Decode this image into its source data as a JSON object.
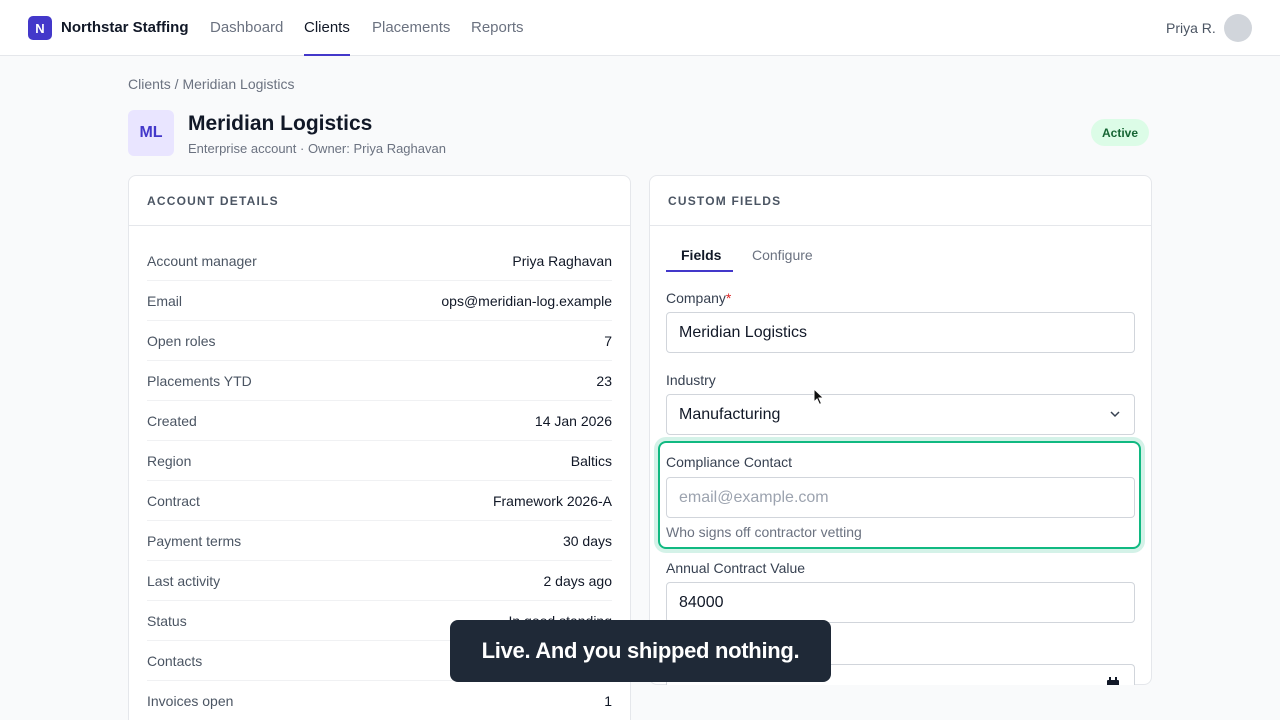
{
  "nav": {
    "logo_letter": "N",
    "brand": "Northstar Staffing",
    "links": [
      "Dashboard",
      "Clients",
      "Placements",
      "Reports"
    ],
    "user": "Priya R."
  },
  "breadcrumb": "Clients / Meridian Logistics",
  "client": {
    "initials": "ML",
    "name": "Meridian Logistics",
    "subtitle": "Enterprise account · Owner: Priya Raghavan",
    "status": "Active"
  },
  "account_details": {
    "header": "ACCOUNT DETAILS",
    "rows": [
      {
        "label": "Account manager",
        "value": "Priya Raghavan"
      },
      {
        "label": "Email",
        "value": "ops@meridian-log.example"
      },
      {
        "label": "Open roles",
        "value": "7"
      },
      {
        "label": "Placements YTD",
        "value": "23"
      },
      {
        "label": "Created",
        "value": "14 Jan 2026"
      },
      {
        "label": "Region",
        "value": "Baltics"
      },
      {
        "label": "Contract",
        "value": "Framework 2026-A"
      },
      {
        "label": "Payment terms",
        "value": "30 days"
      },
      {
        "label": "Last activity",
        "value": "2 days ago"
      },
      {
        "label": "Status",
        "value": "In good standing"
      },
      {
        "label": "Contacts",
        "value": ""
      },
      {
        "label": "Invoices open",
        "value": "1"
      }
    ]
  },
  "custom_fields": {
    "header": "CUSTOM FIELDS",
    "tabs": [
      "Fields",
      "Configure"
    ],
    "company_label": "Company",
    "required_mark": "*",
    "company_value": "Meridian Logistics",
    "industry_label": "Industry",
    "industry_value": "Manufacturing",
    "compliance_label": "Compliance Contact",
    "compliance_placeholder": "email@example.com",
    "compliance_help": "Who signs off contractor vetting",
    "acv_label": "Annual Contract Value",
    "acv_value": "84000"
  },
  "toast": "Live. And you shipped nothing.",
  "colors": {
    "accent": "#4338ca",
    "highlight": "#10b981",
    "active_badge_bg": "#dcfce7"
  }
}
